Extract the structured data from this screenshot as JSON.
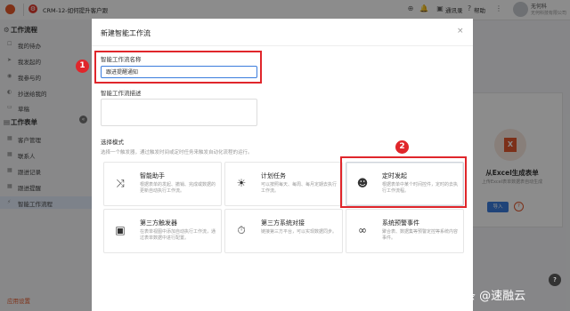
{
  "topbar": {
    "app_title": "CRM-12-如何提升客户跟",
    "contacts_label": "通讯录",
    "help_label": "帮助",
    "user_name": "无何科",
    "company": "无何科技有限公司"
  },
  "sidebar": {
    "section1": "工作流程",
    "items1": [
      "我的待办",
      "我发起的",
      "我参与的",
      "抄送给我的",
      "草稿"
    ],
    "section2": "工作表单",
    "items2": [
      "客户管理",
      "联系人",
      "跟进记录",
      "跟进提醒",
      "智能工作流程"
    ],
    "bottom_label": "应用设置"
  },
  "bg_card": {
    "title": "从Excel生成表单",
    "desc": "上传Excel表单数据表自动生成",
    "button": "导入",
    "help": "?"
  },
  "modal": {
    "title": "新建智能工作流",
    "name_label": "智能工作流名称",
    "name_value": "跟进提醒通知",
    "desc_label": "智能工作流描述",
    "mode_label": "选择模式",
    "mode_hint": "选择一个触发器，通过触发时间或定时任务来触发自动化流程的运行。",
    "cards": [
      {
        "title": "智能助手",
        "desc": "根据表单的发起、撤销、完成或数据的更新自动执行工作流。",
        "icon": "shuffle-icon"
      },
      {
        "title": "计划任务",
        "desc": "可以按照每天、每周、每月定期去执行工作流。",
        "icon": "sun-icon"
      },
      {
        "title": "定时发起",
        "desc": "根据表单中某个时间控件，定时的去执行工作流程。",
        "icon": "robot-icon"
      },
      {
        "title": "第三方触发器",
        "desc": "在表单视图中添加自动执行工作流，通过表单数据中进行配置。",
        "icon": "calendar-check-icon"
      },
      {
        "title": "第三方系统对接",
        "desc": "链接第三方平台，可以实现数据同步。",
        "icon": "stopwatch-icon"
      },
      {
        "title": "系统预警事件",
        "desc": "聚合表、数据集等预警定控等系统内容事件。",
        "icon": "link-icon"
      }
    ]
  },
  "annotations": {
    "badge1": "1",
    "badge2": "2"
  },
  "watermark": "头条 @速融云",
  "colors": {
    "accent": "#3b7ddd",
    "annotation": "#e0262b",
    "brand": "#e85a2a"
  }
}
